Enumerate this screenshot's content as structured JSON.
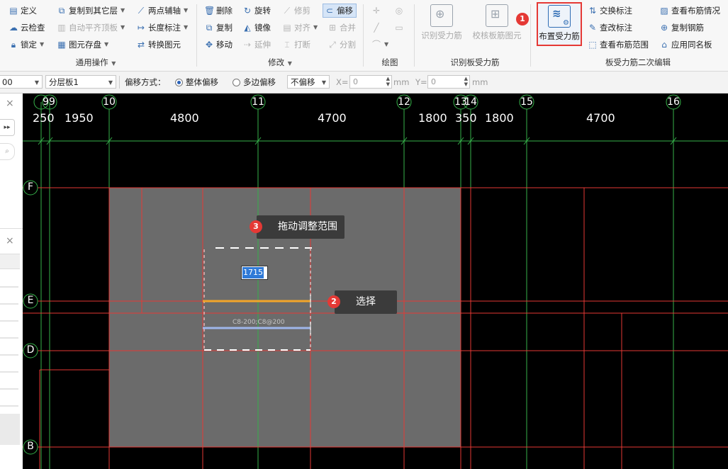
{
  "ribbon": {
    "common": {
      "define": "定义",
      "copy_to_floor": "复制到其它层",
      "two_point_axis": "两点辅轴",
      "cloud_check": "云检查",
      "auto_align_slab": "自动平齐顶板",
      "length_dim": "长度标注",
      "lock": "锁定",
      "element_save": "图元存盘",
      "convert_element": "转换图元",
      "group_label": "通用操作"
    },
    "modify": {
      "delete": "删除",
      "rotate": "旋转",
      "trim": "修剪",
      "offset": "偏移",
      "copy": "复制",
      "mirror": "镜像",
      "align": "对齐",
      "merge": "合并",
      "move": "移动",
      "extend": "延伸",
      "break": "打断",
      "split": "分割",
      "group_label": "修改"
    },
    "draw": {
      "group_label": "绘图"
    },
    "identify": {
      "identify_rebar": "识别受力筋",
      "check_rebar": "校核板筋图元",
      "group_label": "识别板受力筋"
    },
    "secondary": {
      "place_rebar": "布置受力筋",
      "swap_label": "交换标注",
      "check_change_label": "查改标注",
      "view_range": "查看布筋范围",
      "view_status": "查看布筋情况",
      "copy_rebar": "复制钢筋",
      "apply_same_slab": "应用同名板",
      "group_label": "板受力筋二次编辑"
    }
  },
  "badges": {
    "b1": "1",
    "b2": "2",
    "b3": "3"
  },
  "propbar": {
    "sel1_value": "00",
    "layer_value": "分层板1",
    "offset_mode_label": "偏移方式：",
    "whole_offset": "整体偏移",
    "multi_edge_offset": "多边偏移",
    "no_offset": "不偏移",
    "x_label": "X=",
    "x_value": "0",
    "y_label": "Y=",
    "y_value": "0",
    "unit": "mm"
  },
  "canvas": {
    "axis_top": [
      "99",
      "10",
      "11",
      "12",
      "13",
      "14",
      "15",
      "16"
    ],
    "dims": [
      "250",
      "1950",
      "4800",
      "4700",
      "1800",
      "350",
      "1800",
      "4700"
    ],
    "axis_left": [
      "F",
      "E",
      "D",
      "B"
    ],
    "length_input": "1715",
    "rebar_label": "C8-200;C8@200",
    "tooltip_drag": "拖动调整范围",
    "tooltip_select": "选择"
  },
  "colors": {
    "grid_red": "#e53935",
    "axis_green": "#36b24a",
    "slab_gray": "#6b6b6b",
    "rebar_yellow": "#f2a52a",
    "rebar_blue": "#9fb6ea",
    "highlight_red": "#e53935"
  }
}
